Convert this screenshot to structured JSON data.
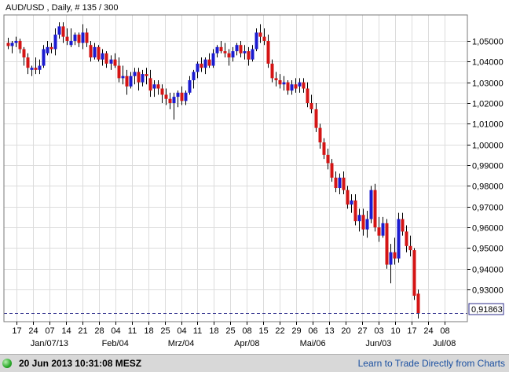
{
  "header": {
    "title": "AUD/USD , Daily, # 135 / 300"
  },
  "status": {
    "timestamp": "20 Jun 2013 10:31:08 MESZ",
    "link": "Learn to Trade Directly from Charts"
  },
  "colors": {
    "up": "#1b1bd0",
    "down": "#d41414",
    "current_line": "#2b2b8a",
    "grid": "#dcdcdc"
  },
  "chart_data": {
    "type": "candlestick",
    "title": "AUD/USD , Daily, # 135 / 300",
    "ylim": [
      0.9145,
      1.0625
    ],
    "ytick_labels": [
      "0,93000",
      "0,94000",
      "0,95000",
      "0,96000",
      "0,97000",
      "0,98000",
      "0,99000",
      "1,00000",
      "1,01000",
      "1,02000",
      "1,03000",
      "1,04000",
      "1,05000"
    ],
    "ytick_values": [
      0.93,
      0.94,
      0.95,
      0.96,
      0.97,
      0.98,
      0.99,
      1.0,
      1.01,
      1.02,
      1.03,
      1.04,
      1.05
    ],
    "current_price": 0.91863,
    "current_price_label": "0,91863",
    "grid": true,
    "x_day_labels": [
      "17",
      "24",
      "07",
      "14",
      "21",
      "28",
      "04",
      "11",
      "18",
      "25",
      "04",
      "11",
      "18",
      "25",
      "08",
      "15",
      "22",
      "29",
      "06",
      "13",
      "20",
      "27",
      "03",
      "10",
      "17",
      "24",
      "08"
    ],
    "x_month_labels": [
      "Jan/07/13",
      "Feb/04",
      "Mrz/04",
      "Apr/08",
      "Mai/06",
      "Jun/03",
      "Jul/08"
    ],
    "candles": [
      [
        1.049,
        1.0515,
        1.046,
        1.0475
      ],
      [
        1.0475,
        1.05,
        1.044,
        1.049
      ],
      [
        1.049,
        1.052,
        1.047,
        1.05
      ],
      [
        1.05,
        1.051,
        1.044,
        1.046
      ],
      [
        1.046,
        1.047,
        1.038,
        1.042
      ],
      [
        1.042,
        1.044,
        1.034,
        1.037
      ],
      [
        1.036,
        1.038,
        1.033,
        1.037
      ],
      [
        1.037,
        1.042,
        1.034,
        1.036
      ],
      [
        1.036,
        1.041,
        1.034,
        1.038
      ],
      [
        1.038,
        1.048,
        1.037,
        1.046
      ],
      [
        1.044,
        1.05,
        1.043,
        1.047
      ],
      [
        1.047,
        1.049,
        1.044,
        1.046
      ],
      [
        1.046,
        1.056,
        1.043,
        1.053
      ],
      [
        1.053,
        1.059,
        1.051,
        1.057
      ],
      [
        1.057,
        1.059,
        1.049,
        1.052
      ],
      [
        1.052,
        1.056,
        1.048,
        1.05
      ],
      [
        1.048,
        1.056,
        1.047,
        1.05
      ],
      [
        1.05,
        1.054,
        1.048,
        1.053
      ],
      [
        1.053,
        1.054,
        1.047,
        1.049
      ],
      [
        1.049,
        1.058,
        1.046,
        1.054
      ],
      [
        1.054,
        1.056,
        1.047,
        1.049
      ],
      [
        1.048,
        1.05,
        1.04,
        1.042
      ],
      [
        1.042,
        1.049,
        1.041,
        1.047
      ],
      [
        1.047,
        1.048,
        1.04,
        1.041
      ],
      [
        1.041,
        1.046,
        1.038,
        1.044
      ],
      [
        1.044,
        1.045,
        1.037,
        1.039
      ],
      [
        1.039,
        1.043,
        1.036,
        1.041
      ],
      [
        1.041,
        1.044,
        1.037,
        1.038
      ],
      [
        1.038,
        1.042,
        1.03,
        1.032
      ],
      [
        1.032,
        1.038,
        1.029,
        1.033
      ],
      [
        1.033,
        1.036,
        1.024,
        1.028
      ],
      [
        1.028,
        1.035,
        1.027,
        1.033
      ],
      [
        1.033,
        1.037,
        1.029,
        1.035
      ],
      [
        1.035,
        1.037,
        1.026,
        1.03
      ],
      [
        1.03,
        1.036,
        1.028,
        1.034
      ],
      [
        1.034,
        1.037,
        1.029,
        1.033
      ],
      [
        1.032,
        1.036,
        1.023,
        1.026
      ],
      [
        1.027,
        1.031,
        1.023,
        1.029
      ],
      [
        1.029,
        1.031,
        1.024,
        1.027
      ],
      [
        1.027,
        1.029,
        1.02,
        1.024
      ],
      [
        1.024,
        1.027,
        1.019,
        1.022
      ],
      [
        1.022,
        1.025,
        1.017,
        1.02
      ],
      [
        1.02,
        1.025,
        1.012,
        1.023
      ],
      [
        1.023,
        1.026,
        1.018,
        1.025
      ],
      [
        1.025,
        1.028,
        1.019,
        1.021
      ],
      [
        1.021,
        1.026,
        1.019,
        1.025
      ],
      [
        1.025,
        1.033,
        1.024,
        1.031
      ],
      [
        1.031,
        1.036,
        1.027,
        1.035
      ],
      [
        1.035,
        1.04,
        1.032,
        1.039
      ],
      [
        1.039,
        1.042,
        1.035,
        1.037
      ],
      [
        1.037,
        1.042,
        1.034,
        1.041
      ],
      [
        1.041,
        1.044,
        1.037,
        1.038
      ],
      [
        1.038,
        1.046,
        1.037,
        1.044
      ],
      [
        1.044,
        1.048,
        1.042,
        1.047
      ],
      [
        1.047,
        1.05,
        1.044,
        1.045
      ],
      [
        1.045,
        1.049,
        1.042,
        1.044
      ],
      [
        1.044,
        1.046,
        1.038,
        1.042
      ],
      [
        1.042,
        1.047,
        1.04,
        1.045
      ],
      [
        1.045,
        1.049,
        1.043,
        1.048
      ],
      [
        1.048,
        1.05,
        1.042,
        1.044
      ],
      [
        1.044,
        1.048,
        1.041,
        1.045
      ],
      [
        1.045,
        1.047,
        1.038,
        1.041
      ],
      [
        1.041,
        1.048,
        1.04,
        1.046
      ],
      [
        1.046,
        1.056,
        1.045,
        1.054
      ],
      [
        1.054,
        1.058,
        1.049,
        1.052
      ],
      [
        1.052,
        1.056,
        1.048,
        1.05
      ],
      [
        1.05,
        1.053,
        1.037,
        1.039
      ],
      [
        1.039,
        1.041,
        1.03,
        1.032
      ],
      [
        1.032,
        1.035,
        1.028,
        1.031
      ],
      [
        1.031,
        1.034,
        1.027,
        1.029
      ],
      [
        1.029,
        1.033,
        1.026,
        1.03
      ],
      [
        1.03,
        1.031,
        1.024,
        1.026
      ],
      [
        1.026,
        1.031,
        1.024,
        1.029
      ],
      [
        1.029,
        1.032,
        1.025,
        1.027
      ],
      [
        1.028,
        1.032,
        1.025,
        1.03
      ],
      [
        1.03,
        1.032,
        1.025,
        1.027
      ],
      [
        1.027,
        1.03,
        1.018,
        1.02
      ],
      [
        1.02,
        1.024,
        1.015,
        1.017
      ],
      [
        1.017,
        1.02,
        1.006,
        1.008
      ],
      [
        1.008,
        1.01,
        0.998,
        1.001
      ],
      [
        1.001,
        1.003,
        0.993,
        0.995
      ],
      [
        0.995,
        0.998,
        0.988,
        0.991
      ],
      [
        0.991,
        0.993,
        0.982,
        0.984
      ],
      [
        0.984,
        0.987,
        0.977,
        0.979
      ],
      [
        0.979,
        0.986,
        0.976,
        0.984
      ],
      [
        0.984,
        0.987,
        0.976,
        0.978
      ],
      [
        0.978,
        0.98,
        0.969,
        0.971
      ],
      [
        0.971,
        0.976,
        0.967,
        0.973
      ],
      [
        0.973,
        0.976,
        0.961,
        0.963
      ],
      [
        0.963,
        0.969,
        0.958,
        0.966
      ],
      [
        0.966,
        0.969,
        0.956,
        0.959
      ],
      [
        0.959,
        0.968,
        0.955,
        0.964
      ],
      [
        0.964,
        0.98,
        0.962,
        0.978
      ],
      [
        0.978,
        0.981,
        0.958,
        0.96
      ],
      [
        0.96,
        0.965,
        0.953,
        0.956
      ],
      [
        0.956,
        0.965,
        0.955,
        0.962
      ],
      [
        0.962,
        0.964,
        0.94,
        0.942
      ],
      [
        0.942,
        0.952,
        0.933,
        0.948
      ],
      [
        0.948,
        0.955,
        0.942,
        0.945
      ],
      [
        0.945,
        0.967,
        0.943,
        0.964
      ],
      [
        0.964,
        0.967,
        0.956,
        0.958
      ],
      [
        0.958,
        0.961,
        0.948,
        0.951
      ],
      [
        0.951,
        0.956,
        0.946,
        0.949
      ],
      [
        0.949,
        0.95,
        0.925,
        0.927
      ],
      [
        0.928,
        0.93,
        0.916,
        0.9186
      ]
    ]
  }
}
